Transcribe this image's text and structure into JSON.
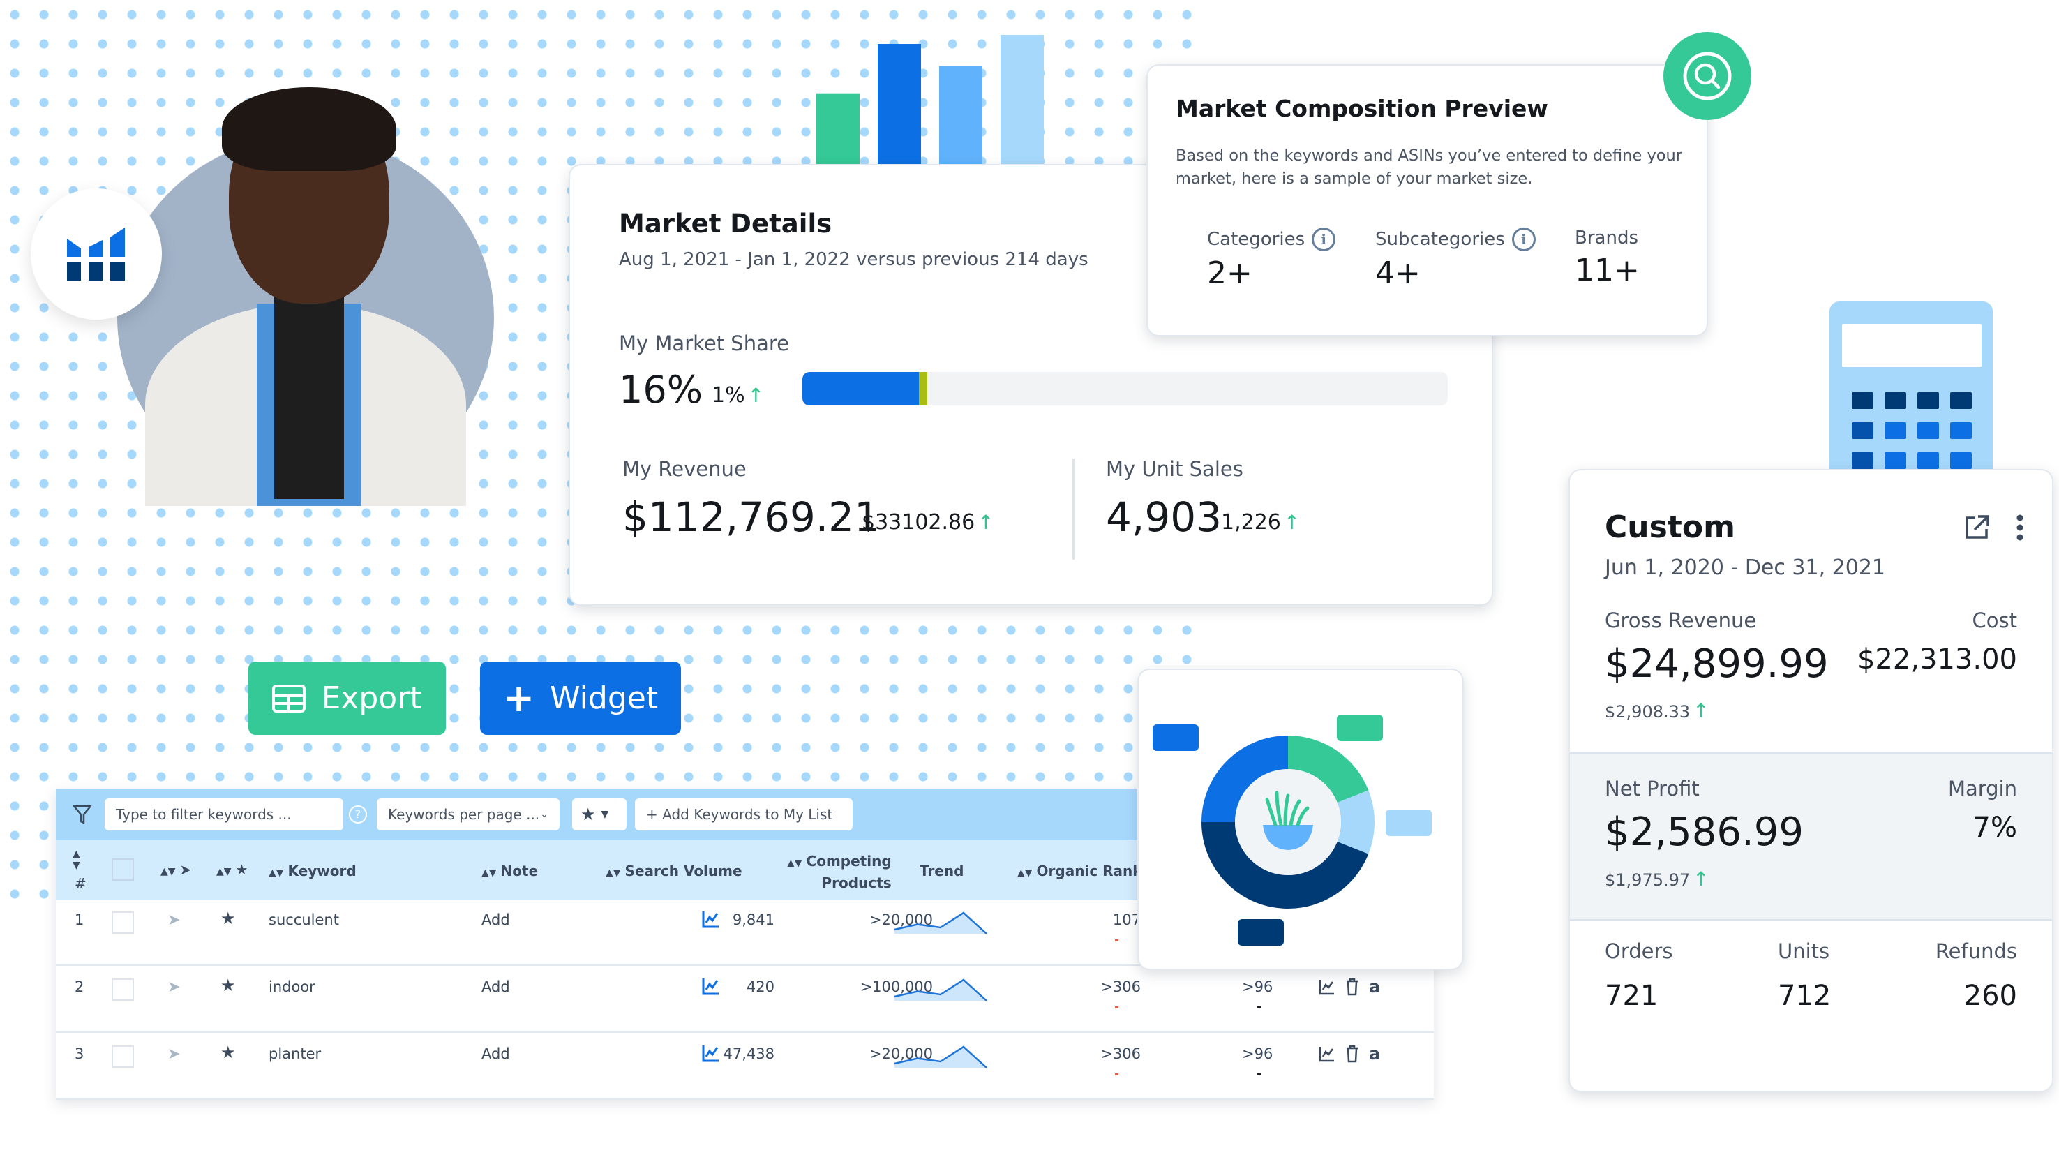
{
  "logo_badge": {
    "icon": "analytics-bars-logo-icon"
  },
  "avatar": {
    "description": "person-photo"
  },
  "decorative_bars": {
    "values": [
      0.55,
      0.93,
      0.76,
      1.0
    ],
    "colors": [
      "#34c996",
      "#0c6fe3",
      "#5fb2fb",
      "#a6d8fb"
    ]
  },
  "market_details": {
    "title": "Market Details",
    "subtitle": "Aug 1, 2021 - Jan 1, 2022 versus previous 214 days",
    "market_share": {
      "label": "My Market Share",
      "value": "16%",
      "delta": "1%",
      "share_fraction": 0.18,
      "delta_fraction": 0.013
    },
    "revenue": {
      "label": "My Revenue",
      "value": "$112,769.21",
      "delta": "$33102.86"
    },
    "unit_sales": {
      "label": "My Unit Sales",
      "value": "4,903",
      "delta": "1,226"
    },
    "arrow": "↑"
  },
  "market_composition": {
    "title": "Market Composition Preview",
    "description": "Based on the keywords and ASINs you’ve entered to define your market, here is a sample of your market size.",
    "stats": [
      {
        "label": "Categories",
        "value": "2+",
        "has_info": true
      },
      {
        "label": "Subcategories",
        "value": "4+",
        "has_info": true
      },
      {
        "label": "Brands",
        "value": "11+",
        "has_info": false
      }
    ],
    "info_glyph": "i"
  },
  "custom_card": {
    "title": "Custom",
    "date_range": "Jun 1, 2020 - Dec 31, 2021",
    "gross_revenue": {
      "label": "Gross Revenue",
      "value": "$24,899.99",
      "delta": "$2,908.33"
    },
    "cost": {
      "label": "Cost",
      "value": "$22,313.00"
    },
    "net_profit": {
      "label": "Net Profit",
      "value": "$2,586.99",
      "delta": "$1,975.97"
    },
    "margin": {
      "label": "Margin",
      "value": "7%"
    },
    "orders": {
      "label": "Orders",
      "value": "721"
    },
    "units": {
      "label": "Units",
      "value": "712"
    },
    "refunds": {
      "label": "Refunds",
      "value": "260"
    },
    "arrow": "↑"
  },
  "buttons": {
    "export": "Export",
    "widget": "Widget",
    "widget_prefix": "+"
  },
  "keyword_table": {
    "toolbar": {
      "filter_placeholder": "Type to filter keywords ...",
      "per_page_select": "Keywords per page ...",
      "add_button": "+ Add Keywords to My List",
      "help_glyph": "?"
    },
    "columns": {
      "index": "#",
      "keyword": "Keyword",
      "note": "Note",
      "search_volume": "Search Volume",
      "competing_1": "Competing",
      "competing_2": "Products",
      "trend": "Trend",
      "organic_rank": "Organic Rank"
    },
    "rows": [
      {
        "index": "1",
        "keyword": "succulent",
        "note": "Add",
        "search_volume": "9,841",
        "competing": ">20,000",
        "trend": [
          0.2,
          0.45,
          0.3,
          1.0,
          0.0
        ],
        "organic_rank": "107",
        "col2": ""
      },
      {
        "index": "2",
        "keyword": "indoor",
        "note": "Add",
        "search_volume": "420",
        "competing": ">100,000",
        "trend": [
          0.2,
          0.45,
          0.3,
          1.0,
          0.0
        ],
        "organic_rank": ">306",
        "col2": ">96"
      },
      {
        "index": "3",
        "keyword": "planter",
        "note": "Add",
        "search_volume": "47,438",
        "competing": ">20,000",
        "trend": [
          0.2,
          0.45,
          0.3,
          1.0,
          0.0
        ],
        "organic_rank": ">306",
        "col2": ">96"
      }
    ]
  },
  "donut_widget": {
    "segments": [
      {
        "name": "green",
        "fraction": 0.19,
        "color": "#34c996"
      },
      {
        "name": "light-blue",
        "fraction": 0.12,
        "color": "#a6d8fb"
      },
      {
        "name": "navy",
        "fraction": 0.44,
        "color": "#003a75"
      },
      {
        "name": "blue",
        "fraction": 0.25,
        "color": "#0c6fe3"
      }
    ]
  },
  "colors": {
    "green": "#34c996",
    "blue": "#0c6fe3",
    "navy": "#003a75",
    "light_blue": "#a6d8fb",
    "mid_blue": "#5fb2fb",
    "up_arrow": "#34c38f"
  }
}
